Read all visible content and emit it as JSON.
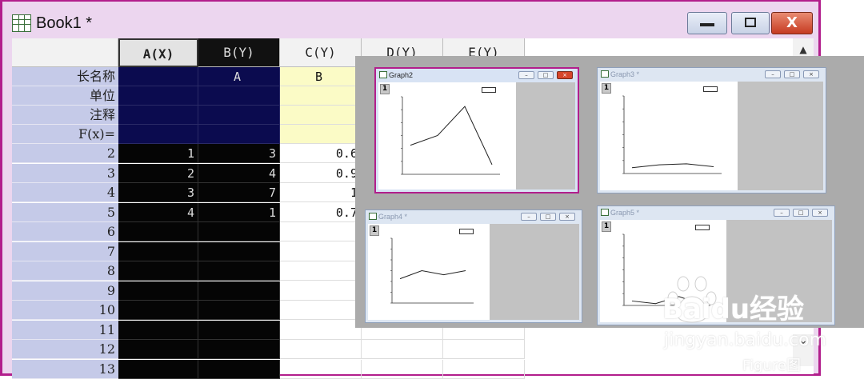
{
  "window": {
    "title": "Book1 *",
    "close_glyph": "X",
    "min_glyph": "▬",
    "max_glyph": "▢"
  },
  "columns": [
    "A(X)",
    "B(Y)",
    "C(Y)",
    "D(Y)",
    "E(Y)"
  ],
  "meta_rows": [
    {
      "label": "长名称",
      "values": [
        "",
        "A",
        "B",
        "",
        ""
      ]
    },
    {
      "label": "单位",
      "values": [
        "",
        "",
        "",
        "",
        ""
      ]
    },
    {
      "label": "注释",
      "values": [
        "",
        "",
        "",
        "",
        ""
      ]
    },
    {
      "label": "F(x)=",
      "values": [
        "",
        "",
        "",
        "",
        ""
      ]
    }
  ],
  "rows": [
    {
      "label": "2",
      "values": [
        "1",
        "3",
        "0.6",
        "",
        ""
      ]
    },
    {
      "label": "3",
      "values": [
        "2",
        "4",
        "0.9",
        "",
        ""
      ]
    },
    {
      "label": "4",
      "values": [
        "3",
        "7",
        "1",
        "",
        ""
      ]
    },
    {
      "label": "5",
      "values": [
        "4",
        "1",
        "0.7",
        "",
        ""
      ]
    },
    {
      "label": "6",
      "values": [
        "",
        "",
        "",
        "",
        ""
      ]
    },
    {
      "label": "7",
      "values": [
        "",
        "",
        "",
        "",
        ""
      ]
    },
    {
      "label": "8",
      "values": [
        "",
        "",
        "",
        "",
        ""
      ]
    },
    {
      "label": "9",
      "values": [
        "",
        "",
        "",
        "",
        ""
      ]
    },
    {
      "label": "10",
      "values": [
        "",
        "",
        "",
        "",
        ""
      ]
    },
    {
      "label": "11",
      "values": [
        "",
        "",
        "",
        "",
        ""
      ]
    },
    {
      "label": "12",
      "values": [
        "",
        "",
        "",
        "",
        ""
      ]
    },
    {
      "label": "13",
      "values": [
        "",
        "",
        "",
        "",
        ""
      ]
    }
  ],
  "graphs": [
    {
      "title": "Graph2",
      "layer": "1",
      "active": true,
      "series": [
        3,
        4,
        7,
        1
      ]
    },
    {
      "title": "Graph3 *",
      "layer": "1",
      "active": false,
      "series": [
        0.6,
        0.9,
        1,
        0.7
      ]
    },
    {
      "title": "Graph4 *",
      "layer": "1",
      "active": false,
      "series": [
        3,
        4,
        3.5,
        4
      ]
    },
    {
      "title": "Graph5 *",
      "layer": "1",
      "active": false,
      "series": [
        0.5,
        0.2,
        1,
        0.1
      ]
    }
  ],
  "watermark": {
    "brand": "Baidu经验",
    "url": "jingyan.baidu.com",
    "extra": "Figure图"
  },
  "colors": {
    "window_border": "#b21e8c",
    "navy_selection": "#0b0b4f",
    "yellow_cells": "#fbfbc6",
    "row_header": "#c5cae8"
  }
}
